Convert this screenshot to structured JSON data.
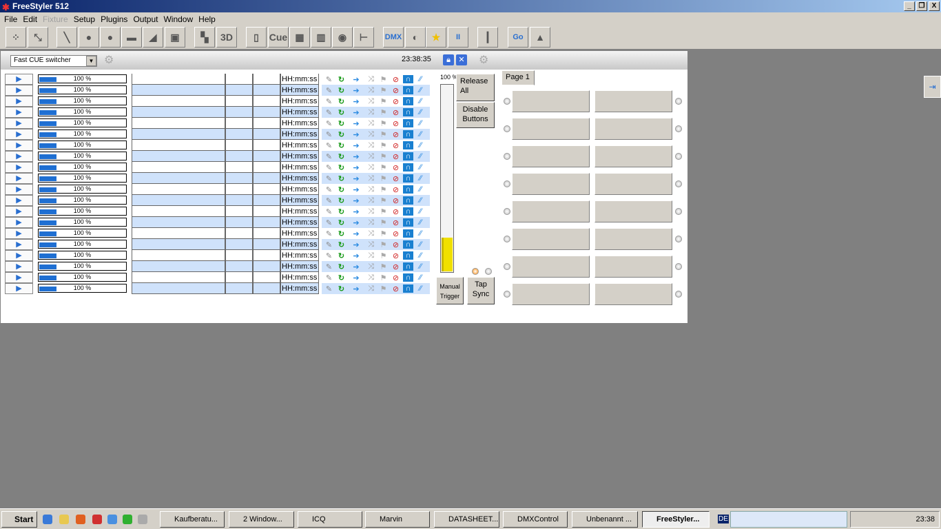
{
  "window": {
    "title": "FreeStyler 512",
    "buttons": [
      "_",
      "❐",
      "X"
    ]
  },
  "menu": [
    {
      "label": "File"
    },
    {
      "label": "Edit"
    },
    {
      "label": "Fixture",
      "disabled": true
    },
    {
      "label": "Setup"
    },
    {
      "label": "Plugins"
    },
    {
      "label": "Output"
    },
    {
      "label": "Window"
    },
    {
      "label": "Help"
    }
  ],
  "toolbar": [
    {
      "icon": "fixtures-icon",
      "g": "⁘"
    },
    {
      "icon": "unselect-fixtures-icon",
      "g": "⤡"
    },
    {
      "icon": "pan-icon",
      "g": "╲"
    },
    {
      "icon": "gobo-icon",
      "g": "●"
    },
    {
      "icon": "gobo2-icon",
      "g": "●"
    },
    {
      "icon": "effects-icon",
      "g": "▬"
    },
    {
      "icon": "prism-icon",
      "g": "◢"
    },
    {
      "icon": "frame-icon",
      "g": "▣"
    },
    {
      "icon": "group-icon",
      "g": "▚"
    },
    {
      "icon": "3d-icon",
      "g": "3D"
    },
    {
      "icon": "new-icon",
      "g": "▯"
    },
    {
      "icon": "cue-icon",
      "g": "Cue"
    },
    {
      "icon": "keyboard-icon",
      "g": "▦"
    },
    {
      "icon": "faders-icon",
      "g": "▥"
    },
    {
      "icon": "speaker-icon",
      "g": "◉"
    },
    {
      "icon": "beam-icon",
      "g": "⊢"
    },
    {
      "icon": "dmx-icon",
      "g": "DMX"
    },
    {
      "icon": "light-icon",
      "g": "◐"
    },
    {
      "icon": "star-icon",
      "g": "★"
    },
    {
      "icon": "pause-icon",
      "g": "II"
    },
    {
      "icon": "master-fader-icon",
      "g": "┃"
    },
    {
      "icon": "go-icon",
      "g": "Go"
    },
    {
      "icon": "blackout-icon",
      "g": "▲"
    }
  ],
  "panel": {
    "selector": "Fast CUE switcher",
    "clock": "23:38:35",
    "time_placeholder": "HH:mm:ss",
    "percent": "100 %",
    "progress_value": 100,
    "release_all": "Release All",
    "disable_buttons": "Disable Buttons",
    "master_label": "100 %",
    "master_level": 18,
    "manual_trigger": "Manual Trigger",
    "tap_sync": "Tap Sync",
    "page_tab": "Page 1",
    "row_count": 20,
    "page_buttons": 16
  },
  "taskbar": {
    "start": "Start",
    "tasks": [
      {
        "label": "Kaufberatu..."
      },
      {
        "label": "2 Window..."
      },
      {
        "label": "ICQ"
      },
      {
        "label": "Marvin"
      },
      {
        "label": "DATASHEET..."
      },
      {
        "label": "DMXControl"
      },
      {
        "label": "Unbenannt ..."
      },
      {
        "label": "FreeStyler...",
        "active": true
      }
    ],
    "lang": "DE",
    "clock": "23:38"
  }
}
